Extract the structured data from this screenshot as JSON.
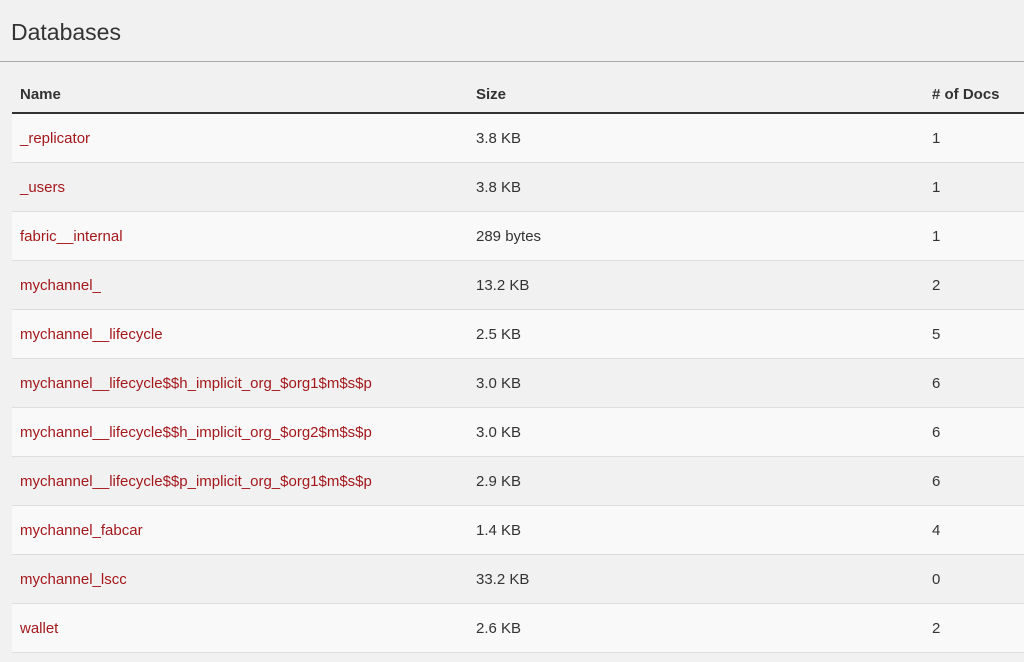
{
  "header": {
    "title": "Databases"
  },
  "table": {
    "columns": [
      "Name",
      "Size",
      "# of Docs"
    ],
    "rows": [
      {
        "name": "_replicator",
        "size": "3.8 KB",
        "docs": "1"
      },
      {
        "name": "_users",
        "size": "3.8 KB",
        "docs": "1"
      },
      {
        "name": "fabric__internal",
        "size": "289 bytes",
        "docs": "1"
      },
      {
        "name": "mychannel_",
        "size": "13.2 KB",
        "docs": "2"
      },
      {
        "name": "mychannel__lifecycle",
        "size": "2.5 KB",
        "docs": "5"
      },
      {
        "name": "mychannel__lifecycle$$h_implicit_org_$org1$m$s$p",
        "size": "3.0 KB",
        "docs": "6"
      },
      {
        "name": "mychannel__lifecycle$$h_implicit_org_$org2$m$s$p",
        "size": "3.0 KB",
        "docs": "6"
      },
      {
        "name": "mychannel__lifecycle$$p_implicit_org_$org1$m$s$p",
        "size": "2.9 KB",
        "docs": "6"
      },
      {
        "name": "mychannel_fabcar",
        "size": "1.4 KB",
        "docs": "4"
      },
      {
        "name": "mychannel_lscc",
        "size": "33.2 KB",
        "docs": "0"
      },
      {
        "name": "wallet",
        "size": "2.6 KB",
        "docs": "2"
      }
    ]
  },
  "colors": {
    "link": "#a4181c",
    "text": "#333333",
    "background": "#f1f1f1"
  }
}
